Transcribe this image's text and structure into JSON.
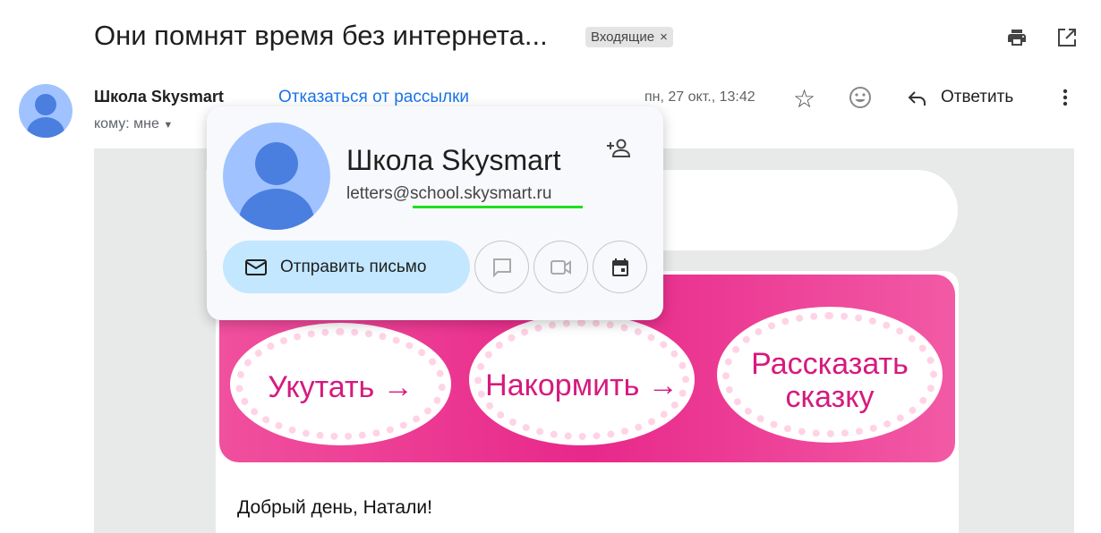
{
  "subject": "Они помнят время без интернета...",
  "label": {
    "text": "Входящие",
    "close": "×"
  },
  "sender": {
    "name": "Школа Skysmart",
    "unsubscribe": "Отказаться от рассылки",
    "to": "кому: мне",
    "date": "пн, 27 окт., 13:42"
  },
  "actions": {
    "reply": "Ответить"
  },
  "popup": {
    "name": "Школа Skysmart",
    "email": "letters@school.skysmart.ru",
    "send": "Отправить письмо"
  },
  "banner": {
    "items": [
      "Укутать →",
      "Накормить →",
      "Рассказать сказку"
    ]
  },
  "body": {
    "greeting": "Добрый день, Натали!"
  }
}
